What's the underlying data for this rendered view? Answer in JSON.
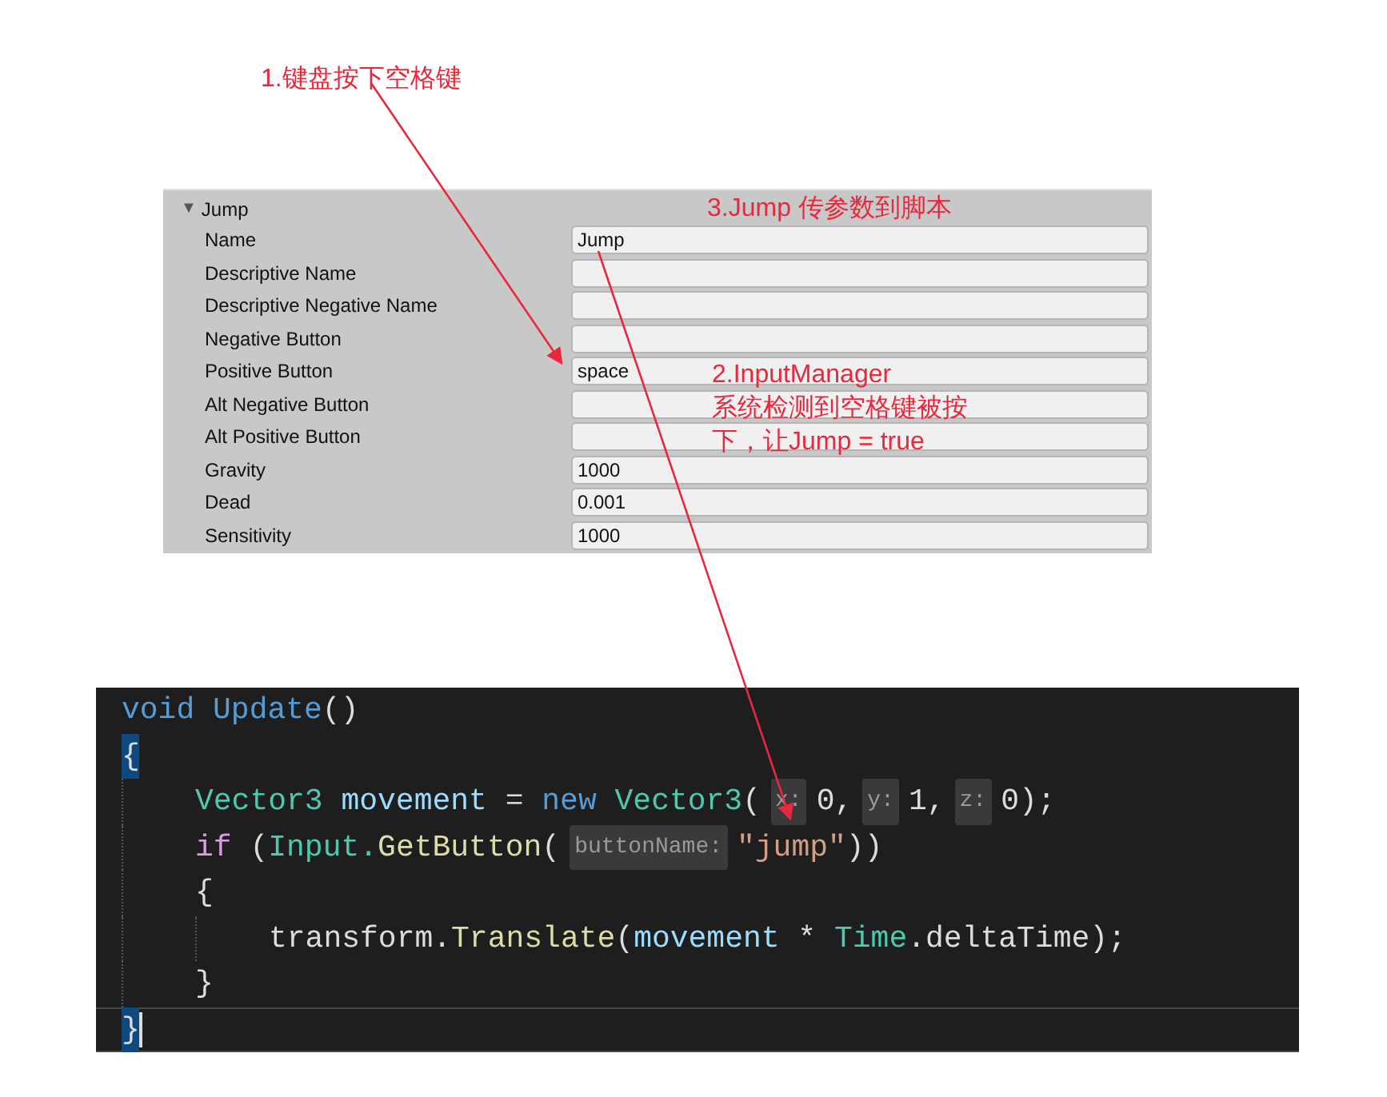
{
  "annotations": [
    {
      "text": "1.键盘按下空格键"
    },
    {
      "text": "3.Jump 传参数到脚本"
    },
    {
      "lines": [
        "2.InputManager",
        "系统检测到空格键被按",
        "下，让Jump = true"
      ]
    }
  ],
  "inspector": {
    "group": {
      "toggle": "▼",
      "label": "Jump",
      "expanded": true
    },
    "fields": [
      {
        "label": "Name",
        "value": "Jump"
      },
      {
        "label": "Descriptive Name"
      },
      {
        "label": "Descriptive Negative Name"
      },
      {
        "label": "Negative Button"
      },
      {
        "label": "Positive Button",
        "value": "space"
      },
      {
        "label": "Alt Negative Button"
      },
      {
        "label": "Alt Positive Button"
      },
      {
        "label": "Gravity",
        "value": "1000"
      },
      {
        "label": "Dead",
        "value": "0.001"
      },
      {
        "label": "Sensitivity",
        "value": "1000"
      }
    ]
  },
  "code": {
    "lines": [
      {
        "tokens": [
          {
            "kind": "keyword",
            "text": "void Update"
          },
          {
            "kind": "plain",
            "text": "()"
          }
        ]
      },
      {
        "tokens": [
          {
            "kind": "brace",
            "text": "{",
            "highlighted": true
          }
        ],
        "children": [
          {
            "tokens": [
              {
                "kind": "type",
                "text": "Vector3 "
              },
              {
                "kind": "variable",
                "text": "movement"
              },
              {
                "kind": "plain",
                "text": " = "
              },
              {
                "kind": "keyword",
                "text": "new "
              },
              {
                "kind": "type",
                "text": "Vector3"
              },
              {
                "kind": "plain",
                "text": "("
              },
              {
                "kind": "hint",
                "text": "x:"
              },
              {
                "kind": "plain",
                "text": "0,"
              },
              {
                "kind": "hint",
                "text": "y:"
              },
              {
                "kind": "plain",
                "text": "1,"
              },
              {
                "kind": "hint",
                "text": "z:"
              },
              {
                "kind": "plain",
                "text": "0);"
              }
            ]
          },
          {
            "tokens": [
              {
                "kind": "control",
                "text": "if "
              },
              {
                "kind": "plain",
                "text": "("
              },
              {
                "kind": "type",
                "text": "Input."
              },
              {
                "kind": "method",
                "text": "GetButton"
              },
              {
                "kind": "plain",
                "text": "("
              },
              {
                "kind": "hint",
                "text": "buttonName:"
              },
              {
                "kind": "string",
                "text": "\"jump\""
              },
              {
                "kind": "plain",
                "text": "))"
              }
            ]
          },
          {
            "tokens": [
              {
                "kind": "brace",
                "text": "{",
                "highlighted": false
              }
            ],
            "children": [
              {
                "tokens": [
                  {
                    "kind": "plain",
                    "text": "transform."
                  },
                  {
                    "kind": "method",
                    "text": "Translate"
                  },
                  {
                    "kind": "plain",
                    "text": "("
                  },
                  {
                    "kind": "variable",
                    "text": "movement"
                  },
                  {
                    "kind": "plain",
                    "text": " * "
                  },
                  {
                    "kind": "type",
                    "text": "Time"
                  },
                  {
                    "kind": "plain",
                    "text": ".deltaTime);"
                  }
                ]
              }
            ]
          },
          {
            "tokens": [
              {
                "kind": "brace",
                "text": "}",
                "highlighted": false
              }
            ]
          }
        ]
      },
      {
        "tokens": [
          {
            "kind": "brace",
            "text": "}",
            "highlighted": true
          }
        ],
        "current": true
      }
    ]
  }
}
